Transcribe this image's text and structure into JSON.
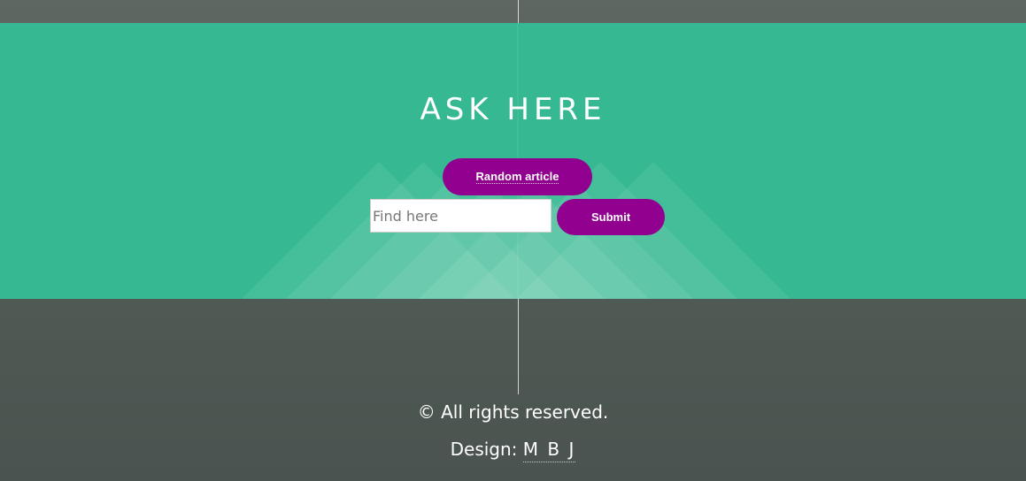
{
  "colors": {
    "background": "#555d58",
    "banner": "#36b992",
    "button": "#92008f",
    "text": "#ffffff"
  },
  "banner": {
    "title": "ASK HERE",
    "random_button_label": "Random article",
    "search_placeholder": "Find here",
    "search_value": "",
    "submit_label": "Submit"
  },
  "footer": {
    "copyright": "© All rights reserved.",
    "design_label": "Design:",
    "design_credit": "M B J"
  }
}
